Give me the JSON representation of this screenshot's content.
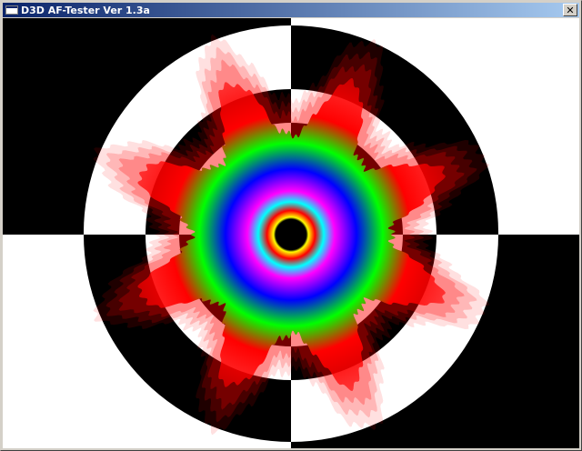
{
  "window": {
    "title": "D3D AF-Tester Ver 1.3a",
    "close_glyph": "✕",
    "app_icon": "window-icon",
    "close_icon": "close-icon"
  },
  "render": {
    "description_icon": "af-tunnel-render",
    "colors": {
      "titlebar_start": "#0a246a",
      "titlebar_end": "#a6caf0",
      "red": "#ff0000",
      "green": "#00ff00",
      "blue": "#0000ff",
      "magenta": "#ff00ff",
      "yellow": "#ffff00",
      "black": "#000000",
      "white": "#ffffff"
    }
  }
}
